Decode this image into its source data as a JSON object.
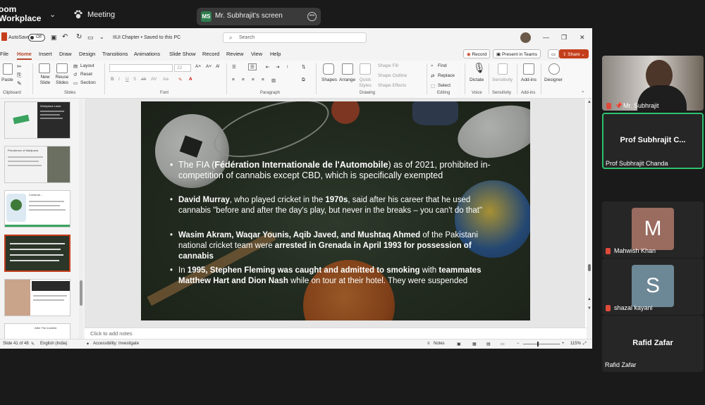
{
  "zoom": {
    "brand_line1": "oom",
    "brand_line2": "Workplace",
    "meeting_label": "Meeting",
    "share_initials": "MS",
    "share_title": "Mr. Subhrajit's screen"
  },
  "ppt": {
    "autosave": "AutoSave",
    "autosave_state": "Off",
    "doc_title": "IIUI Chapter • Saved to this PC",
    "search_placeholder": "Search",
    "tabs": [
      "File",
      "Home",
      "Insert",
      "Draw",
      "Design",
      "Transitions",
      "Animations",
      "Slide Show",
      "Record",
      "Review",
      "View",
      "Help"
    ],
    "active_tab": "Home",
    "record_btn": "Record",
    "present_btn": "Present in Teams",
    "share_btn": "Share",
    "ribbon": {
      "paste": "Paste",
      "new_slide": "New Slide",
      "reuse_slides": "Reuse Slides",
      "layout": "Layout",
      "reset": "Reset",
      "section": "Section",
      "font_size": "22",
      "shapes": "Shapes",
      "arrange": "Arrange",
      "quick_styles": "Quick Styles",
      "shape_fill": "Shape Fill",
      "shape_outline": "Shape Outline",
      "shape_effects": "Shape Effects",
      "find": "Find",
      "replace": "Replace",
      "select": "Select",
      "dictate": "Dictate",
      "sensitivity": "Sensitivity",
      "addins": "Add-ins",
      "designer": "Designer",
      "groups": [
        "Clipboard",
        "Slides",
        "Font",
        "Paragraph",
        "Drawing",
        "Editing",
        "Voice",
        "Sensitivity",
        "Add-ins"
      ]
    },
    "thumbnails": [
      {
        "num": "",
        "title": "Workplace Laws"
      },
      {
        "num": "",
        "title": "Prevalence of Marijuana"
      },
      {
        "num": "",
        "title": "Continue..."
      },
      {
        "num": "",
        "title": ""
      },
      {
        "num": "",
        "title": ""
      },
      {
        "num": "",
        "title": "After The incident"
      }
    ],
    "slide": {
      "bullets": [
        {
          "parts": [
            {
              "t": "The FIA (",
              "b": false
            },
            {
              "t": "Fédération Internationale de l'Automobile",
              "b": true
            },
            {
              "t": ") as of 2021, prohibited in-competition of cannabis except CBD, which is specifically exempted",
              "b": false
            }
          ]
        },
        {
          "parts": [
            {
              "t": "David Murray",
              "b": true
            },
            {
              "t": ", who played cricket in the ",
              "b": false
            },
            {
              "t": "1970s",
              "b": true
            },
            {
              "t": ", said after his career that he used cannabis \"before and after the day's play, but never in the breaks – you can't do that\"",
              "b": false
            }
          ]
        },
        {
          "parts": [
            {
              "t": "Wasim Akram, Waqar Younis, Aqib Javed, and Mushtaq Ahmed",
              "b": true
            },
            {
              "t": " of the Pakistani national cricket team were ",
              "b": false
            },
            {
              "t": "arrested in Grenada in April 1993 for possession of cannabis",
              "b": true
            }
          ]
        },
        {
          "parts": [
            {
              "t": "In ",
              "b": false
            },
            {
              "t": "1995, Stephen Fleming was caught and admitted to smoking",
              "b": true
            },
            {
              "t": " with ",
              "b": false
            },
            {
              "t": "teammates Matthew Hart and Dion Nash",
              "b": true
            },
            {
              "t": " while on tour at their hotel. They were suspended",
              "b": false
            }
          ]
        }
      ]
    },
    "notes_placeholder": "Click to add notes",
    "status": {
      "slide_count": "Slide 41 of 48",
      "language": "English (India)",
      "accessibility": "Accessibility: Investigate",
      "notes": "Notes",
      "zoom": "115%"
    }
  },
  "participants": [
    {
      "name": "Mr. Subhrajit",
      "type": "video"
    },
    {
      "name": "Prof Subhrajit Chanda",
      "display": "Prof Subhrajit C...",
      "type": "text"
    },
    {
      "name": "Mahwish Khan",
      "initial": "M",
      "color": "#9a6b5f",
      "type": "avatar"
    },
    {
      "name": "shazal kayani",
      "initial": "S",
      "color": "#6c8795",
      "type": "avatar"
    },
    {
      "name": "Rafid Zafar",
      "display": "Rafid Zafar",
      "type": "text"
    }
  ]
}
